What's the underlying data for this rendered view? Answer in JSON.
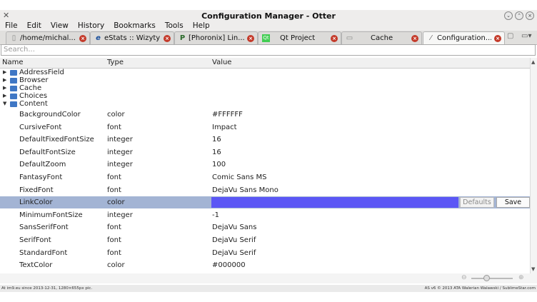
{
  "window": {
    "title": "Configuration Manager - Otter",
    "app_icon": "otter-x-icon"
  },
  "menubar": [
    "File",
    "Edit",
    "View",
    "History",
    "Bookmarks",
    "Tools",
    "Help"
  ],
  "tabs": [
    {
      "label": "/home/michal...",
      "icon": "page-icon"
    },
    {
      "label": "eStats :: Wizyty",
      "icon": "estats-icon"
    },
    {
      "label": "[Phoronix] Lin...",
      "icon": "phoronix-icon"
    },
    {
      "label": "Qt Project",
      "icon": "qt-icon"
    },
    {
      "label": "Cache",
      "icon": "page-icon"
    },
    {
      "label": "Configuration...",
      "icon": "wrench-icon",
      "active": true
    }
  ],
  "search": {
    "placeholder": "Search..."
  },
  "columns": {
    "name": "Name",
    "type": "Type",
    "value": "Value"
  },
  "folders": [
    {
      "label": "AddressField",
      "expanded": false
    },
    {
      "label": "Browser",
      "expanded": false
    },
    {
      "label": "Cache",
      "expanded": false
    },
    {
      "label": "Choices",
      "expanded": false
    },
    {
      "label": "Content",
      "expanded": true
    }
  ],
  "rows": [
    {
      "name": "BackgroundColor",
      "type": "color",
      "value": "#FFFFFF"
    },
    {
      "name": "CursiveFont",
      "type": "font",
      "value": "Impact"
    },
    {
      "name": "DefaultFixedFontSize",
      "type": "integer",
      "value": "16"
    },
    {
      "name": "DefaultFontSize",
      "type": "integer",
      "value": "16"
    },
    {
      "name": "DefaultZoom",
      "type": "integer",
      "value": "100"
    },
    {
      "name": "FantasyFont",
      "type": "font",
      "value": "Comic Sans MS"
    },
    {
      "name": "FixedFont",
      "type": "font",
      "value": "DejaVu Sans Mono"
    },
    {
      "name": "LinkColor",
      "type": "color",
      "value": "",
      "selected": true,
      "swatch": "#5b57f5"
    },
    {
      "name": "MinimumFontSize",
      "type": "integer",
      "value": "-1"
    },
    {
      "name": "SansSerifFont",
      "type": "font",
      "value": "DejaVu Sans"
    },
    {
      "name": "SerifFont",
      "type": "font",
      "value": "DejaVu Serif"
    },
    {
      "name": "StandardFont",
      "type": "font",
      "value": "DejaVu Serif"
    },
    {
      "name": "TextColor",
      "type": "color",
      "value": "#000000"
    }
  ],
  "editor": {
    "defaults_label": "Defaults",
    "save_label": "Save"
  },
  "footer": {
    "left": "At im9.eu  since 2013-12-31, 1280×655px pic.",
    "right": "AS v6 © 2013 ATA Walerian Walawski / SublimeStar.com"
  }
}
